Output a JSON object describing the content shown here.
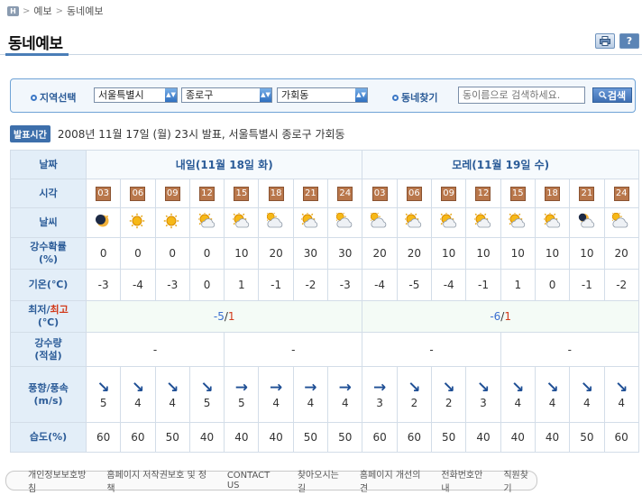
{
  "breadcrumb": {
    "home_icon": "home-icon",
    "items": [
      "예보",
      "동네예보"
    ]
  },
  "page_title": "동네예보",
  "toolbar": {
    "print_icon": "printer-icon",
    "help_label": "?"
  },
  "filter": {
    "region_label": "지역선택",
    "city": "서울특별시",
    "district": "종로구",
    "dong": "가회동",
    "find_label": "동네찾기",
    "search_placeholder": "동이름으로 검색하세요.",
    "search_button": "검색"
  },
  "announcement": {
    "badge": "발표시간",
    "text": "2008년 11월 17일 (월) 23시 발표, 서울특별시 종로구 가회동"
  },
  "table": {
    "labels": {
      "date": "날짜",
      "time": "시각",
      "weather": "날씨",
      "precip_prob_1": "강수확률",
      "precip_prob_2": "(%)",
      "temp": "기온(℃)",
      "minmax_1a": "최저",
      "minmax_1sep": "/",
      "minmax_1b": "최고",
      "minmax_2": "(℃)",
      "precip_1": "강수량",
      "precip_2": "(적설)",
      "wind_1": "풍향/풍속",
      "wind_2": "(m/s)",
      "humidity": "습도(%)"
    },
    "day1": {
      "label": "내일(11월 18일 화)",
      "min": "-5",
      "sep": "/",
      "max": "1",
      "precip": "-",
      "precip2": "-"
    },
    "day2": {
      "label": "모레(11월 19일 수)",
      "min": "-6",
      "sep": "/",
      "max": "1",
      "precip": "-",
      "precip2": "-"
    },
    "hours": [
      "03",
      "06",
      "09",
      "12",
      "15",
      "18",
      "21",
      "24",
      "03",
      "06",
      "09",
      "12",
      "15",
      "18",
      "21",
      "24"
    ],
    "weather_icons": [
      "clear-night-icon",
      "sunny-icon",
      "sunny-icon",
      "partly-cloudy-icon",
      "partly-cloudy-icon",
      "mostly-cloudy-icon",
      "partly-cloudy-icon",
      "mostly-cloudy-icon",
      "mostly-cloudy-icon",
      "partly-cloudy-icon",
      "partly-cloudy-icon",
      "partly-cloudy-icon",
      "partly-cloudy-icon",
      "partly-cloudy-icon",
      "partly-cloudy-night-icon",
      "mostly-cloudy-icon"
    ],
    "precip_prob": [
      "0",
      "0",
      "0",
      "0",
      "10",
      "20",
      "30",
      "30",
      "20",
      "20",
      "10",
      "10",
      "10",
      "10",
      "10",
      "20"
    ],
    "temp": [
      "-3",
      "-4",
      "-3",
      "0",
      "1",
      "-1",
      "-2",
      "-3",
      "-4",
      "-5",
      "-4",
      "-1",
      "1",
      "0",
      "-1",
      "-2"
    ],
    "wind_dir": [
      "↘",
      "↘",
      "↘",
      "↘",
      "→",
      "→",
      "→",
      "→",
      "→",
      "↘",
      "↘",
      "↘",
      "↘",
      "↘",
      "↘",
      "↘"
    ],
    "wind_speed": [
      "5",
      "4",
      "4",
      "5",
      "5",
      "4",
      "4",
      "4",
      "3",
      "2",
      "2",
      "3",
      "4",
      "4",
      "4",
      "4"
    ],
    "humidity": [
      "60",
      "60",
      "50",
      "40",
      "40",
      "40",
      "50",
      "50",
      "60",
      "60",
      "50",
      "40",
      "40",
      "40",
      "50",
      "60"
    ]
  },
  "footer": [
    "개인정보보호방침",
    "홈페이지 저작권보호 및 정책",
    "CONTACT US",
    "찾아오시는길",
    "홈페이지 개선의견",
    "전화번호안내",
    "직원찾기"
  ]
}
